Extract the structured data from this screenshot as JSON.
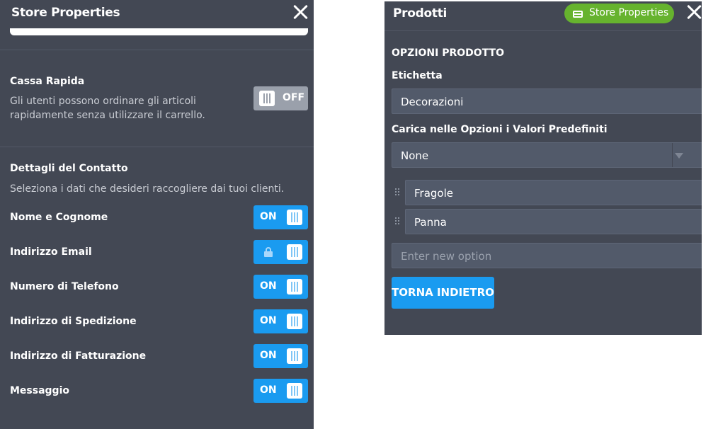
{
  "left_panel": {
    "title": "Store Properties",
    "cassa": {
      "title": "Cassa Rapida",
      "description_line1": "Gli utenti possono ordinare gli articoli",
      "description_line2": "rapidamente senza utilizzare il carrello.",
      "toggle_label": "OFF"
    },
    "contact": {
      "title": "Dettagli del Contatto",
      "description": "Seleziona i dati che desideri raccogliere dai tuoi clienti.",
      "rows": [
        {
          "label": "Nome e Cognome",
          "toggle": "ON"
        },
        {
          "label": "Indirizzo Email",
          "toggle": "locked"
        },
        {
          "label": "Numero di Telefono",
          "toggle": "ON"
        },
        {
          "label": "Indirizzo di Spedizione",
          "toggle": "ON"
        },
        {
          "label": "Indirizzo di Fatturazione",
          "toggle": "ON"
        },
        {
          "label": "Messaggio",
          "toggle": "ON"
        }
      ]
    }
  },
  "right_panel": {
    "title": "Prodotti",
    "badge_label": "Store Properties",
    "section_title": "OPZIONI PRODOTTO",
    "label_title": "Etichetta",
    "label_value": "Decorazioni",
    "defaults_title": "Carica nelle Opzioni i Valori Predefiniti",
    "defaults_value": "None",
    "options": [
      "Fragole",
      "Panna"
    ],
    "new_option_placeholder": "Enter new option",
    "back_button": "TORNA INDIETRO"
  },
  "colors": {
    "panel_bg": "#434854",
    "toggle_on": "#1a9bf0",
    "toggle_off": "#9aa0ab",
    "badge_green": "#66b32e"
  }
}
